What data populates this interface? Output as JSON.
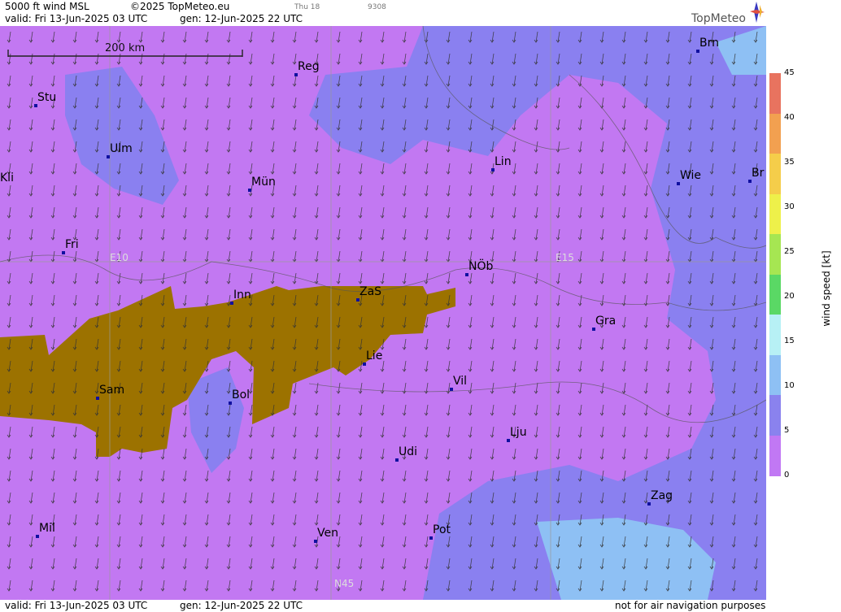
{
  "header": {
    "product": "5000 ft wind MSL",
    "copyright": "©2025 TopMeteo.eu",
    "small_day": "Thu 18",
    "small_code": "9308",
    "valid": "valid:  Fri  13-Jun-2025  03 UTC",
    "gen": "gen: 12-Jun-2025 22 UTC",
    "logo": "TopMeteo"
  },
  "footer": {
    "valid": "valid:  Fri  13-Jun-2025  03 UTC",
    "gen": "gen: 12-Jun-2025 22 UTC",
    "disclaimer": "not for air navigation purposes"
  },
  "scale_bar": {
    "label": "200 km"
  },
  "grid_labels": {
    "e10": "E10",
    "e15": "E15",
    "n45": "N45"
  },
  "legend": {
    "title": "wind  speed  [kt]",
    "ticks": [
      "45",
      "40",
      "35",
      "30",
      "25",
      "20",
      "15",
      "10",
      "5",
      "0"
    ],
    "colors": [
      "#e8735f",
      "#f2a050",
      "#f5cd4a",
      "#eef04a",
      "#a6e652",
      "#5ad865",
      "#b7f0f5",
      "#8ec0f4",
      "#8a82ee",
      "#c178f4"
    ]
  },
  "colors": {
    "terrain": "#9c7200",
    "calm": "#c278f2",
    "light": "#8a80f0",
    "moderate": "#8ec0f4"
  },
  "cities": [
    {
      "name": "Brn"
    },
    {
      "name": "Reg"
    },
    {
      "name": "Stu"
    },
    {
      "name": "Ulm"
    },
    {
      "name": "Kli"
    },
    {
      "name": "Mün"
    },
    {
      "name": "Lin"
    },
    {
      "name": "Wie"
    },
    {
      "name": "Br"
    },
    {
      "name": "Fri"
    },
    {
      "name": "Inn"
    },
    {
      "name": "ZaS"
    },
    {
      "name": "NÖb"
    },
    {
      "name": "Gra"
    },
    {
      "name": "Lie"
    },
    {
      "name": "Sam"
    },
    {
      "name": "Bol"
    },
    {
      "name": "Vil"
    },
    {
      "name": "Lju"
    },
    {
      "name": "Udi"
    },
    {
      "name": "Zag"
    },
    {
      "name": "Mil"
    },
    {
      "name": "Ven"
    },
    {
      "name": "Pot"
    }
  ]
}
